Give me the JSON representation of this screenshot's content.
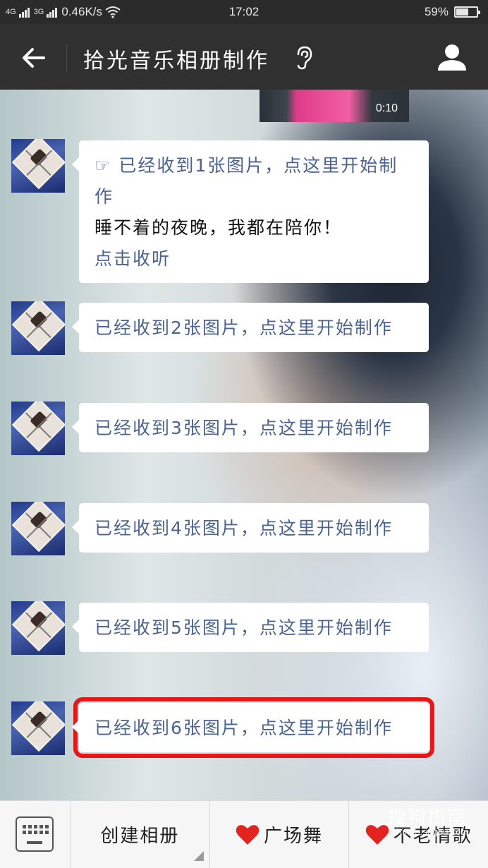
{
  "status_bar": {
    "network_1": "4G",
    "network_2": "3G",
    "speed": "0.46K/s",
    "time": "17:02",
    "battery_text": "59%",
    "battery_level": 0.59
  },
  "header": {
    "title": "拾光音乐相册制作"
  },
  "video": {
    "duration": "0:10"
  },
  "messages": [
    {
      "link": "☞ 已经收到1张图片，点这里开始制作",
      "plain": "睡不着的夜晚，我都在陪你！",
      "extra_link": "点击收听"
    },
    {
      "link": "已经收到2张图片，点这里开始制作"
    },
    {
      "link": "已经收到3张图片，点这里开始制作"
    },
    {
      "link": "已经收到4张图片，点这里开始制作"
    },
    {
      "link": "已经收到5张图片，点这里开始制作"
    },
    {
      "link": "已经收到6张图片，点这里开始制作",
      "highlighted": true
    }
  ],
  "bottom_menu": {
    "items": [
      {
        "label": "创建相册",
        "icon": ""
      },
      {
        "label": "广场舞",
        "icon": "heart-icon"
      },
      {
        "label": "不老情歌",
        "icon": "heart-icon"
      }
    ]
  },
  "watermark": {
    "text": "搜狗指南",
    "sub": "zhinan.sogou.com"
  },
  "colors": {
    "link": "#4b6390",
    "highlight_border": "#e81717",
    "header_bg": "#303030"
  }
}
